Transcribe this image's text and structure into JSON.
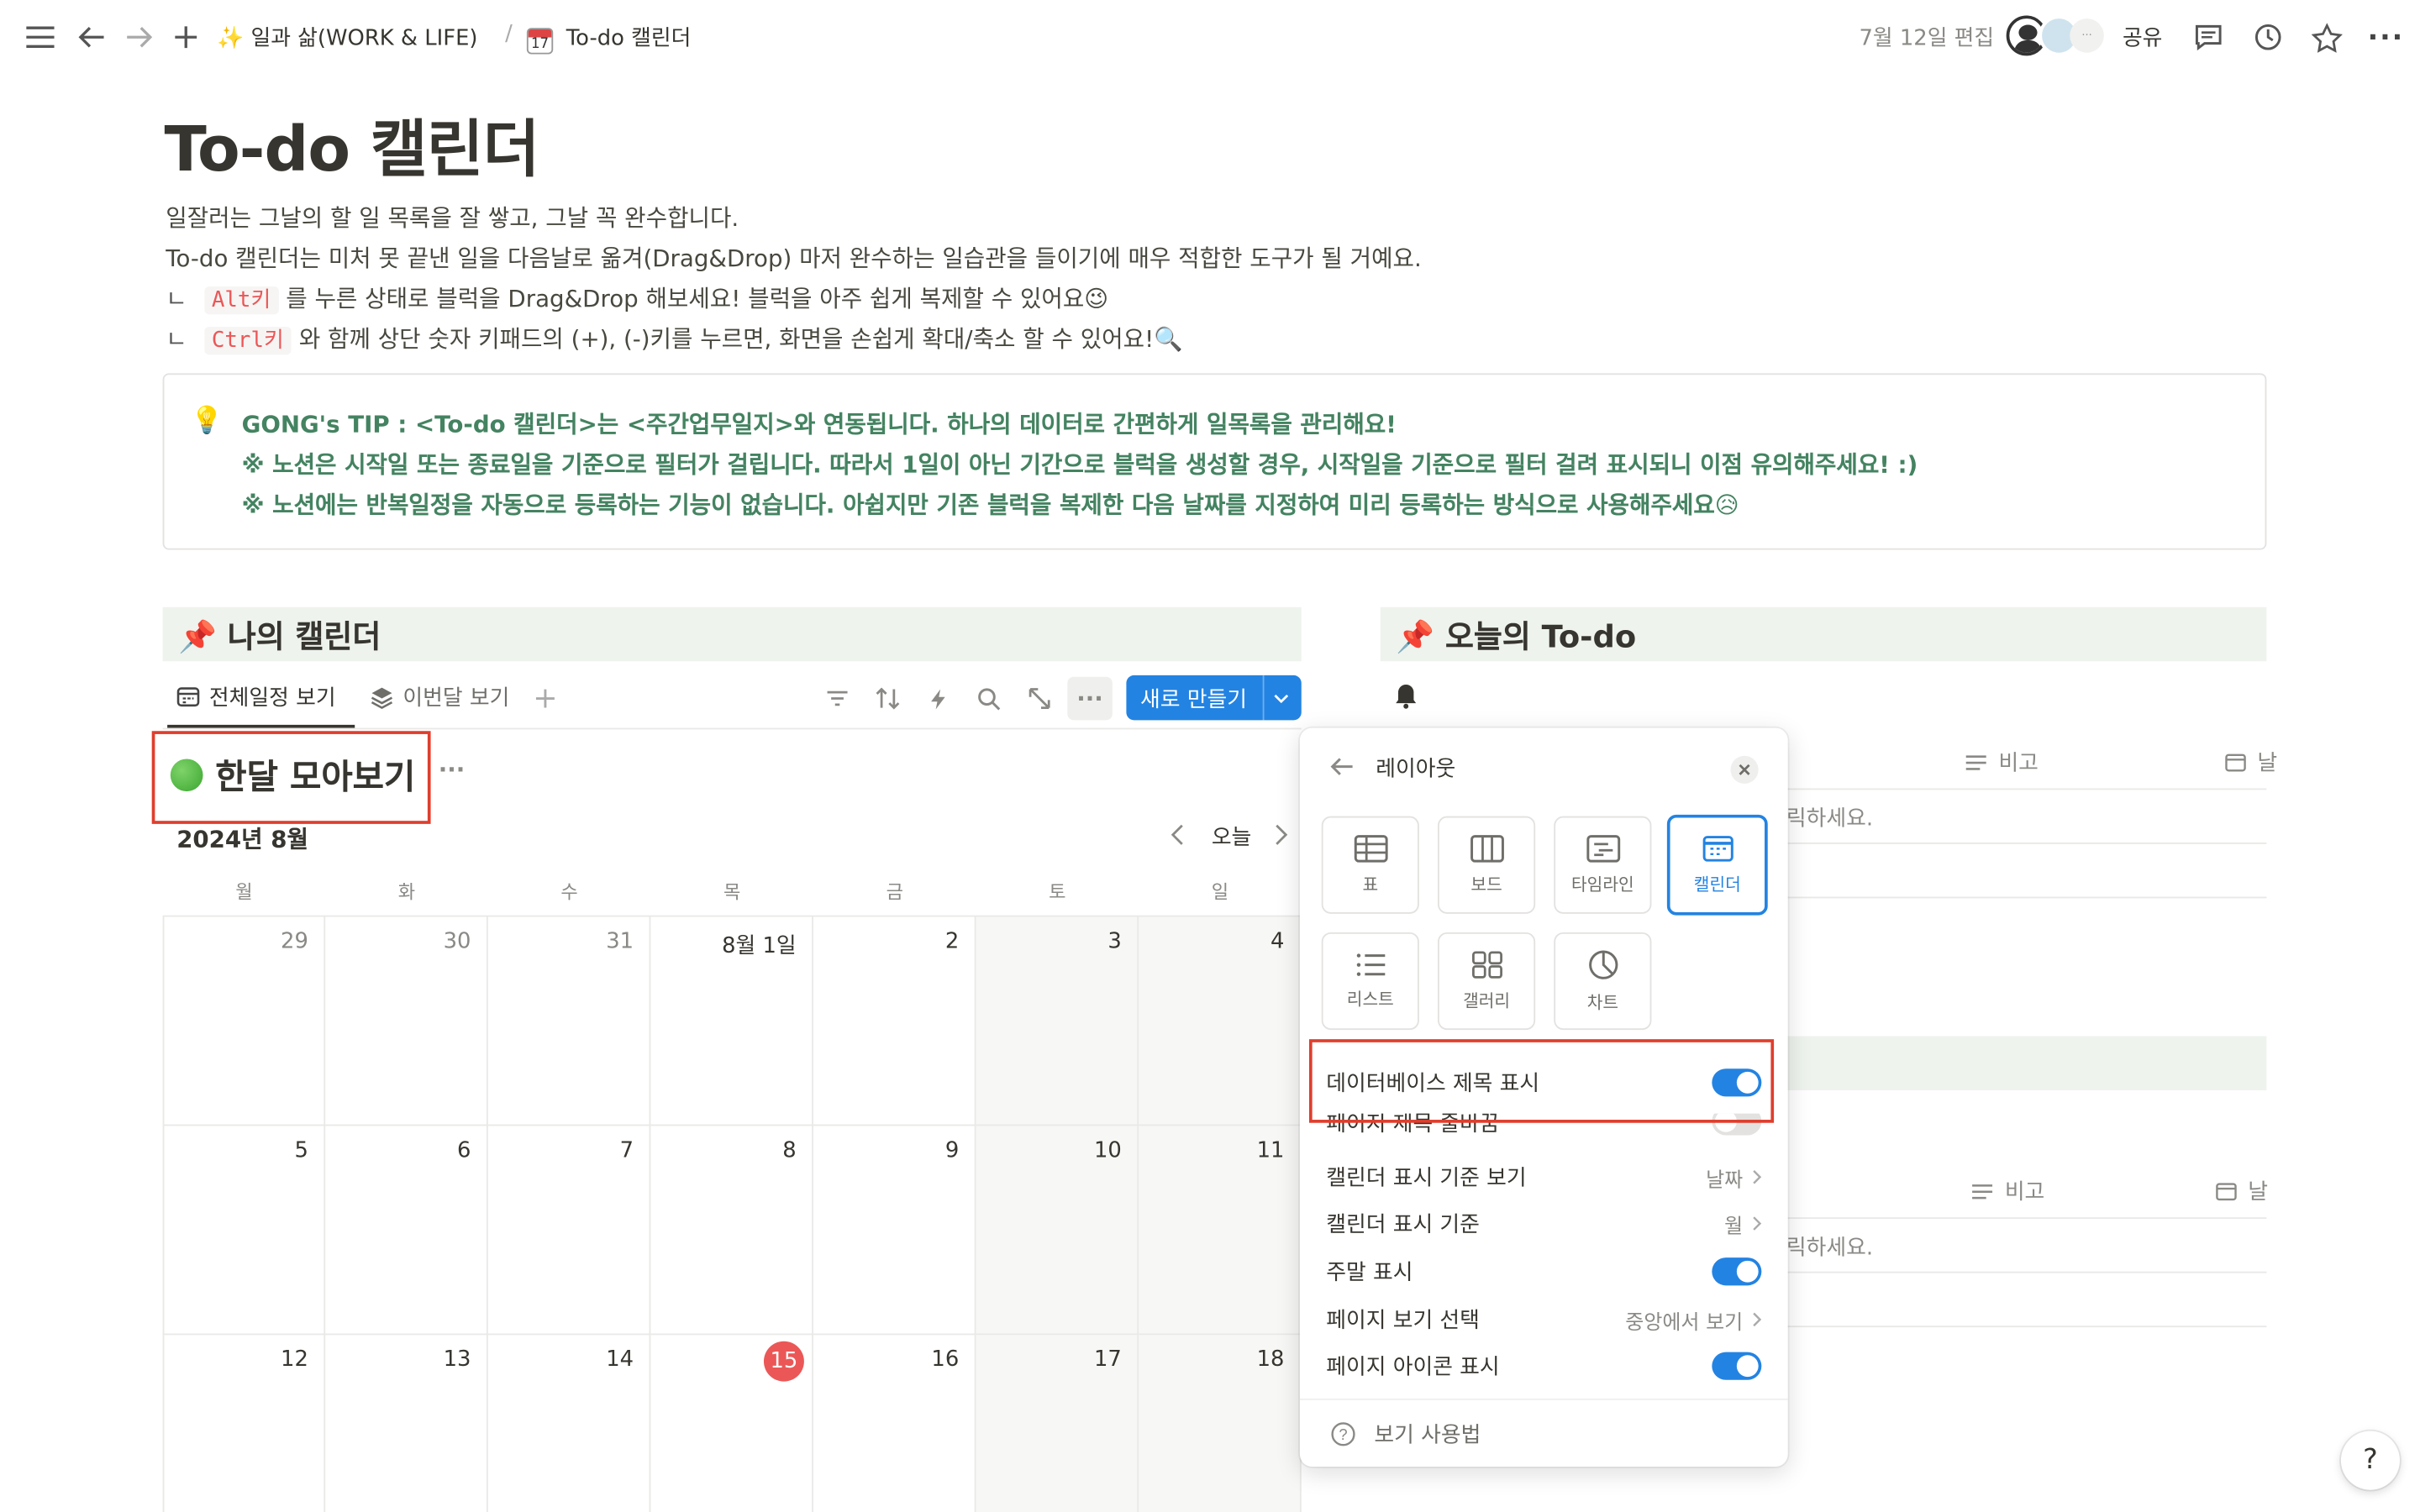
{
  "topbar": {
    "breadcrumb": [
      {
        "icon": "sparkles",
        "label": "일과 삶(WORK & LIFE)"
      },
      {
        "icon": "calendar",
        "label": "To-do 캘린더"
      }
    ],
    "separator": "/",
    "edited": "7월 12일 편집",
    "share_label": "공유"
  },
  "page": {
    "title": "To-do 캘린더",
    "desc_line1": "일잘러는 그날의 할 일 목록을 잘 쌓고, 그날 꼭 완수합니다.",
    "desc_line2": "To-do 캘린더는 미처 못 끝낸 일을 다음날로 옮겨(Drag&Drop) 마저 완수하는 일습관을 들이기에 매우 적합한 도구가 될 거예요.",
    "desc_line3_prefix": "ㄴ",
    "desc_line3_code": "Alt키",
    "desc_line3_text": "를 누른 상태로 블럭을 Drag&Drop 해보세요! 블럭을 아주 쉽게 복제할 수 있어요😉",
    "desc_line4_prefix": "ㄴ",
    "desc_line4_code": "Ctrl키",
    "desc_line4_text": "와 함께 상단 숫자 키패드의 (+), (-)키를 누르면, 화면을 손쉽게 확대/축소 할 수 있어요!🔍"
  },
  "tip": {
    "icon": "lightbulb",
    "line1": "GONG's TIP : <To-do 캘린더>는 <주간업무일지>와 연동됩니다. 하나의 데이터로 간편하게 일목록을 관리해요!",
    "line2": "※ 노션은 시작일 또는 종료일을 기준으로 필터가 걸립니다. 따라서 1일이 아닌 기간으로 블럭을 생성할 경우, 시작일을 기준으로 필터 걸려 표시되니 이점 유의해주세요! :)",
    "line3": "※ 노션에는 반복일정을 자동으로 등록하는 기능이 없습니다. 아쉽지만 기존 블럭을 복제한 다음 날짜를 지정하여 미리 등록하는 방식으로 사용해주세요😥"
  },
  "left_section": {
    "heading": "📌 나의 캘린더",
    "tabs": [
      "전체일정 보기",
      "이번달 보기"
    ],
    "new_button": "새로 만들기",
    "db_title": "한달 모아보기",
    "month_label": "2024년 8월",
    "today_label": "오늘",
    "weekdays": [
      "월",
      "화",
      "수",
      "목",
      "금",
      "토",
      "일"
    ],
    "weeks": [
      [
        "29",
        "30",
        "31",
        "8월 1일",
        "2",
        "3",
        "4"
      ],
      [
        "5",
        "6",
        "7",
        "8",
        "9",
        "10",
        "11"
      ],
      [
        "12",
        "13",
        "14",
        "15",
        "16",
        "17",
        "18"
      ]
    ],
    "today_date": "15",
    "today_color": "#eb5757"
  },
  "right_section": {
    "heading": "📌 오늘의 To-do",
    "col_note": "비고",
    "col_date_1": "날",
    "col_date_2": "날",
    "hint_1": "릭하세요.",
    "hint_2": "릭하세요."
  },
  "popup": {
    "title": "레이아웃",
    "layouts": [
      {
        "label": "표",
        "icon": "table-icon"
      },
      {
        "label": "보드",
        "icon": "board-icon"
      },
      {
        "label": "타임라인",
        "icon": "timeline-icon"
      },
      {
        "label": "캘린더",
        "icon": "calendar-icon",
        "selected": true
      },
      {
        "label": "리스트",
        "icon": "list-icon"
      },
      {
        "label": "갤러리",
        "icon": "gallery-icon"
      },
      {
        "label": "차트",
        "icon": "chart-icon"
      }
    ],
    "show_db_title": "데이터베이스 제목 표시",
    "wrap_page_title": "페이지 제목 줄바꿈",
    "cal_by": "캘린더 표시 기준 보기",
    "cal_by_value": "날짜",
    "cal_basis": "캘린더 표시 기준",
    "cal_basis_value": "월",
    "show_weekends": "주말 표시",
    "page_view": "페이지 보기 선택",
    "page_view_value": "중앙에서 보기",
    "show_icon": "페이지 아이콘 표시",
    "help": "보기 사용법"
  },
  "colors": {
    "accent": "#2383e2",
    "tip_green": "#448361",
    "header_bg": "#eef3ed",
    "highlight_red": "#e03e2d"
  }
}
